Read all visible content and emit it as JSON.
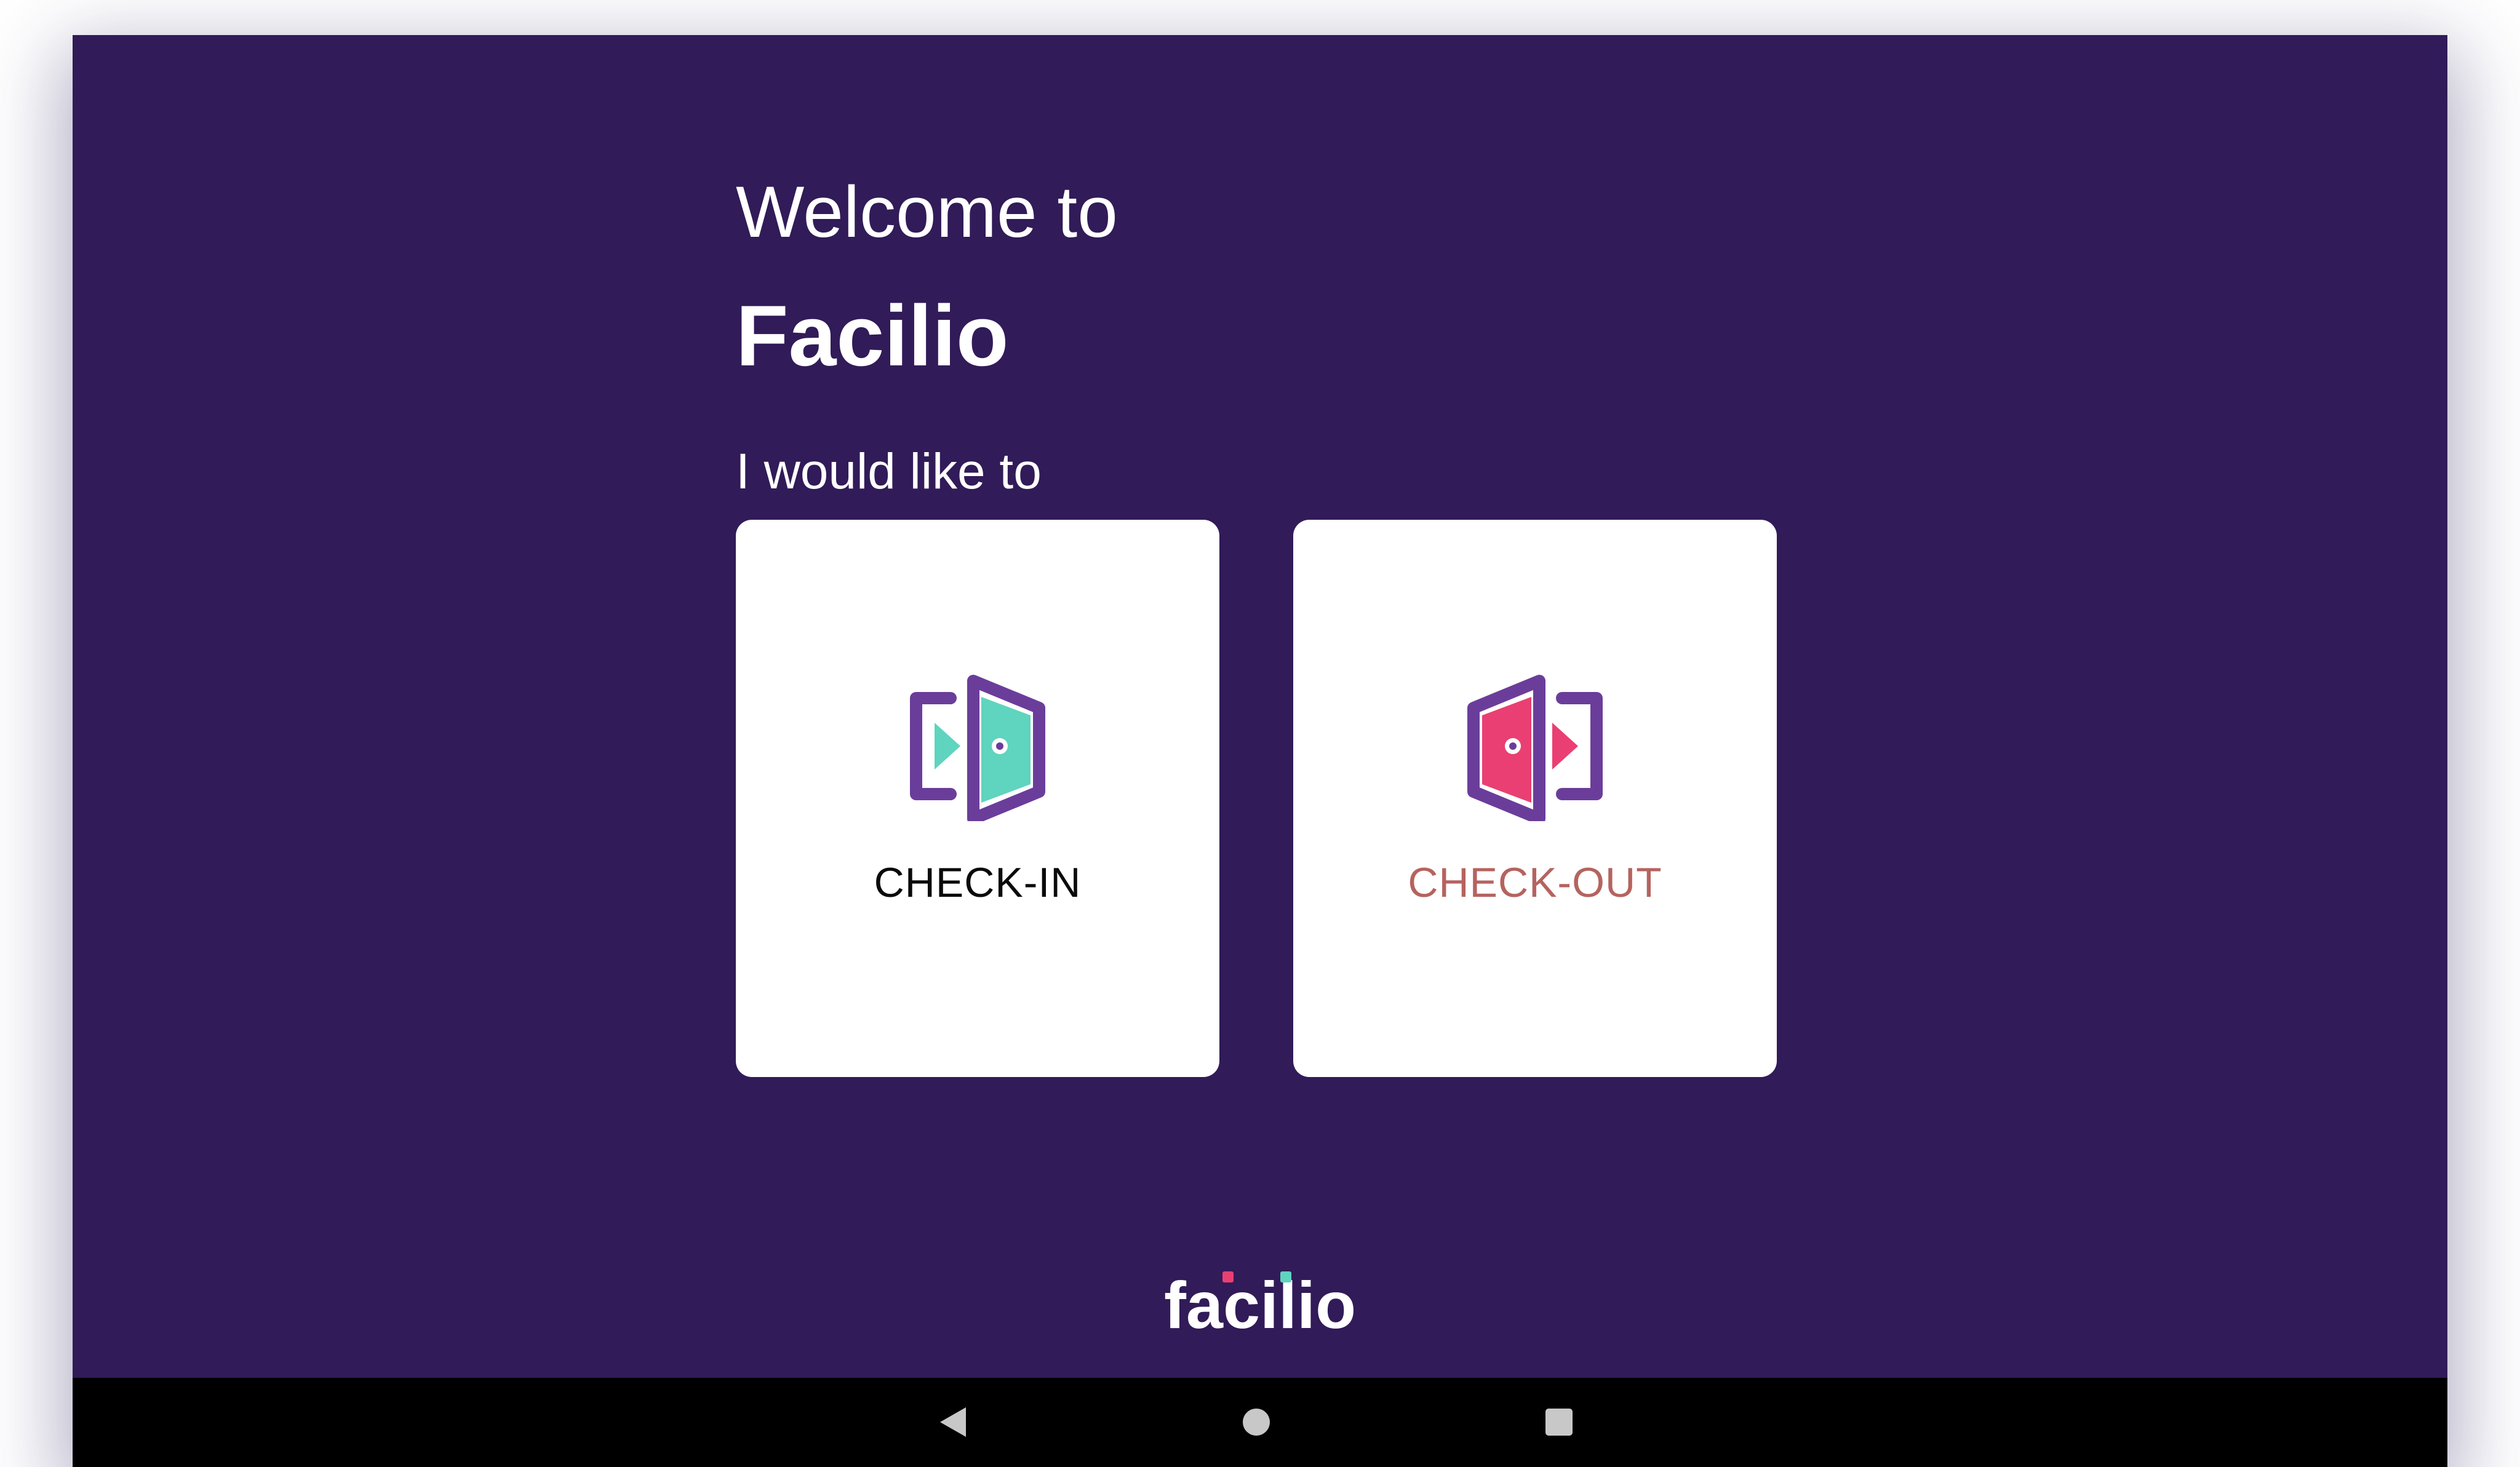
{
  "welcome": {
    "line1": "Welcome to",
    "title": "Facilio",
    "prompt": "I would like to"
  },
  "options": [
    {
      "label": "CHECK-IN",
      "icon": "door-enter-icon",
      "label_color": "#0a0a0a",
      "icon_colors": {
        "frame": "#6b3d9a",
        "door": "#5fd4be"
      }
    },
    {
      "label": "CHECK-OUT",
      "icon": "door-exit-icon",
      "label_color": "#b5635f",
      "icon_colors": {
        "frame": "#6b3d9a",
        "door": "#ea3f72"
      }
    }
  ],
  "footer": {
    "logo_text": "facilio",
    "logo_dot_colors": [
      "#ea3f72",
      "#5fd4be"
    ]
  },
  "system_nav": {
    "buttons": [
      "back-icon",
      "home-icon",
      "recents-icon"
    ]
  },
  "colors": {
    "background": "#311b58",
    "card": "#ffffff",
    "navbar": "#000000"
  }
}
